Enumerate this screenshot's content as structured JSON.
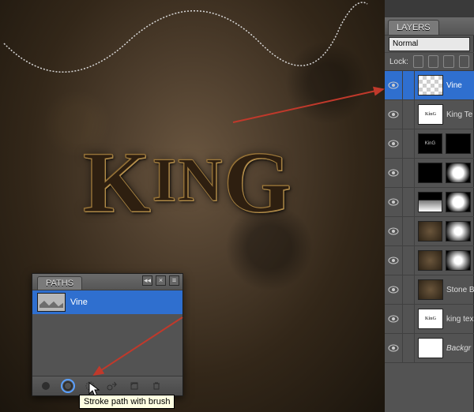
{
  "canvas": {
    "text": "KinG"
  },
  "layersPanel": {
    "tab": "LAYERS",
    "blendMode": "Normal",
    "lockLabel": "Lock:",
    "layers": [
      {
        "name": "Vine",
        "thumb": "checker",
        "selected": true
      },
      {
        "name": "King Te",
        "thumb": "tiny",
        "tinytext": "KinG"
      },
      {
        "name": "",
        "thumb": "kingdark",
        "tinytext": "KinG",
        "secondThumb": "black"
      },
      {
        "name": "",
        "thumb": "black",
        "secondThumb": "rad"
      },
      {
        "name": "",
        "thumb": "grad",
        "secondThumb": "rad"
      },
      {
        "name": "",
        "thumb": "rock",
        "secondThumb": "soft"
      },
      {
        "name": "",
        "thumb": "rock",
        "secondThumb": "soft"
      },
      {
        "name": "Stone B",
        "thumb": "rock"
      },
      {
        "name": "king tex",
        "thumb": "tiny",
        "tinytext": "KinG"
      },
      {
        "name": "Backgr",
        "thumb": "white",
        "italic": true
      }
    ]
  },
  "pathsPanel": {
    "tab": "PATHS",
    "pathName": "Vine",
    "tooltip": "Stroke path with brush",
    "icons": [
      "fill-path",
      "stroke-path",
      "selection-from-path",
      "path-from-selection",
      "new-path",
      "delete-path"
    ]
  }
}
